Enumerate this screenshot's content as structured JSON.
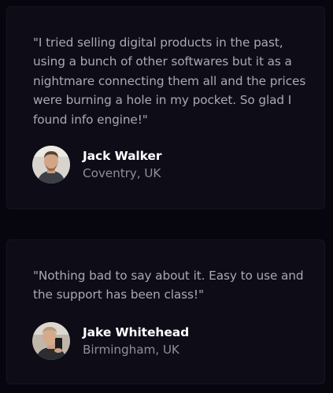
{
  "testimonials": [
    {
      "quote": "\"I tried selling digital products in the past, using a bunch of other softwares but it as a nightmare connecting them all and the prices were burning a hole in my pocket. So glad I found info engine!\"",
      "name": "Jack Walker",
      "location": "Coventry, UK"
    },
    {
      "quote": "\"Nothing bad to say about it. Easy to use and the support has been class!\"",
      "name": "Jake Whitehead",
      "location": "Birmingham, UK"
    }
  ],
  "colors": {
    "page_background": "#07060f",
    "card_background": "#0d0c17",
    "quote_text": "#a9a9b3",
    "name_text": "#ffffff",
    "location_text": "#8e8e98"
  },
  "icons": {
    "avatar_1": "avatar-photo",
    "avatar_2": "avatar-photo"
  }
}
